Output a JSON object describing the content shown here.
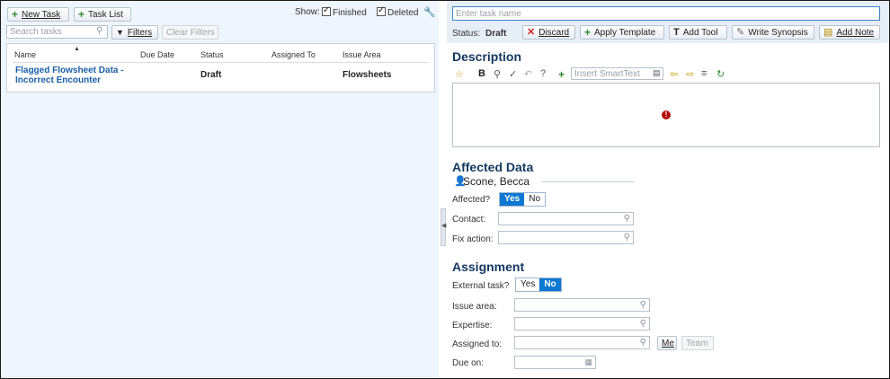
{
  "task_list": {
    "new_task": "New Task",
    "task_list": "Task List",
    "show_label": "Show:",
    "finished_label": "Finished",
    "deleted_label": "Deleted",
    "search_placeholder": "Search tasks",
    "filters": "Filters",
    "clear_filters": "Clear Filters",
    "columns": [
      "Name",
      "Due Date",
      "Status",
      "Assigned To",
      "Issue Area"
    ],
    "rows": [
      {
        "name_line1": "Flagged Flowsheet Data -",
        "name_line2": "Incorrect Encounter",
        "due_date": "",
        "status": "Draft",
        "assigned_to": "",
        "issue_area": "Flowsheets"
      }
    ]
  },
  "task_editor": {
    "name_placeholder": "Enter task name",
    "status_label": "Status:",
    "status_value": "Draft",
    "actions": {
      "discard": "Discard",
      "apply_template": "Apply Template",
      "add_tool": "Add Tool",
      "write_synopsis": "Write Synopsis",
      "add_note": "Add Note"
    },
    "description": {
      "title": "Description",
      "smarttext_placeholder": "Insert SmartText"
    },
    "affected_data": {
      "title": "Affected Data",
      "patient": "Scone, Becca",
      "affected_label": "Affected?",
      "yes": "Yes",
      "no": "No",
      "contact_label": "Contact:",
      "fix_action_label": "Fix action:"
    },
    "assignment": {
      "title": "Assignment",
      "external_label": "External task?",
      "yes": "Yes",
      "no": "No",
      "issue_area_label": "Issue area:",
      "expertise_label": "Expertise:",
      "assigned_to_label": "Assigned to:",
      "me": "Me",
      "team": "Team",
      "due_on_label": "Due on:"
    }
  },
  "colors": {
    "accent": "#0b78d1",
    "link": "#1a5fa8",
    "heading": "#13385f",
    "panel_bg": "#eef5fc",
    "error": "#b30f0f"
  }
}
